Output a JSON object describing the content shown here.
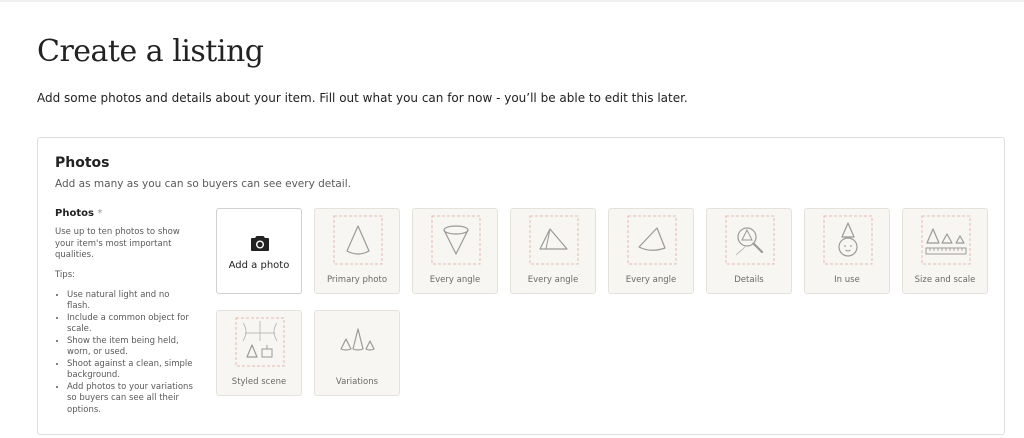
{
  "page": {
    "title": "Create a listing",
    "subtitle": "Add some photos and details about your item. Fill out what you can for now - you’ll be able to edit this later."
  },
  "photos_section": {
    "title": "Photos",
    "description": "Add as many as you can so buyers can see every detail.",
    "help": {
      "label": "Photos",
      "required_mark": "*",
      "text": "Use up to ten photos to show your item's most important qualities.",
      "tips_label": "Tips:",
      "tips": [
        "Use natural light and no flash.",
        "Include a common object for scale.",
        "Show the item being held, worn, or used.",
        "Shoot against a clean, simple background.",
        "Add photos to your variations so buyers can see all their options."
      ]
    },
    "add_photo": {
      "label": "Add a photo",
      "icon": "camera-icon"
    },
    "slots": [
      {
        "label": "Primary photo",
        "icon": "cone-icon"
      },
      {
        "label": "Every angle",
        "icon": "cone-inverted-icon"
      },
      {
        "label": "Every angle",
        "icon": "cone-tilted-icon"
      },
      {
        "label": "Every angle",
        "icon": "cone-side-icon"
      },
      {
        "label": "Details",
        "icon": "magnifier-icon"
      },
      {
        "label": "In use",
        "icon": "person-icon"
      },
      {
        "label": "Size and scale",
        "icon": "ruler-icon"
      },
      {
        "label": "Styled scene",
        "icon": "window-icon"
      },
      {
        "label": "Variations",
        "icon": "cones-icon"
      }
    ]
  }
}
